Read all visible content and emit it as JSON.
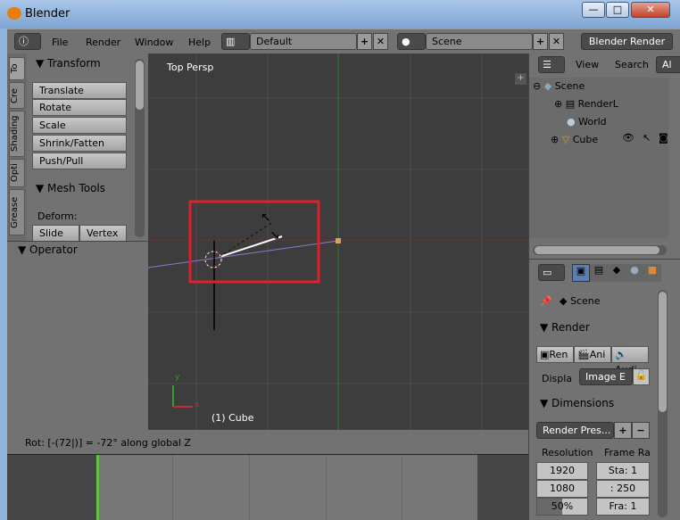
{
  "window": {
    "title": "Blender",
    "minimize": "—",
    "maximize": "□",
    "close": "✕"
  },
  "header": {
    "menus": [
      "File",
      "Render",
      "Window",
      "Help"
    ],
    "layout": "Default",
    "scene": "Scene",
    "engine": "Blender Render",
    "add": "+",
    "remove": "✕"
  },
  "tool_tabs": [
    "To",
    "Cre",
    "Shading",
    "Opti",
    "Grease"
  ],
  "tool_panel": {
    "transform_title": "Transform",
    "transform_buttons": [
      "Translate",
      "Rotate",
      "Scale",
      "Shrink/Fatten",
      "Push/Pull"
    ],
    "mesh_tools_title": "Mesh Tools",
    "deform_label": "Deform:",
    "deform_buttons": [
      "Slide Ed",
      "Vertex"
    ]
  },
  "operator_panel": {
    "title": "Operator"
  },
  "viewport": {
    "view_label": "Top Persp",
    "object_label": "(1) Cube",
    "axis_y": "y",
    "axis_x": "x"
  },
  "status": {
    "text": "Rot: [-(72|)] = -72°  along global Z"
  },
  "outliner": {
    "view": "View",
    "search": "Search",
    "all": "Al",
    "items": [
      {
        "label": "Scene",
        "icon": "scene-icon"
      },
      {
        "label": "RenderL",
        "icon": "render-layers-icon"
      },
      {
        "label": "World",
        "icon": "world-icon"
      },
      {
        "label": "Cube",
        "icon": "mesh-icon"
      }
    ]
  },
  "properties": {
    "context": "Scene",
    "render_title": "Render",
    "render_buttons": [
      "Ren",
      "Ani",
      "Audi"
    ],
    "display_label": "Displa",
    "display_value": "Image E",
    "dimensions_title": "Dimensions",
    "preset": "Render Pres...",
    "resolution_label": "Resolution",
    "frame_range_label": "Frame Ra",
    "res_x": "1920",
    "res_y": "1080",
    "res_pct": "50%",
    "res_pct_value": 50,
    "start": "Sta: 1",
    "end": ": 250",
    "step": "Fra: 1"
  },
  "colors": {
    "viewport_bg": "#3d3d3d",
    "selection_box": "#e0202a",
    "x_axis": "#8a3030",
    "y_axis": "#2f8a2f",
    "timeline_frame": "#5ec442"
  }
}
